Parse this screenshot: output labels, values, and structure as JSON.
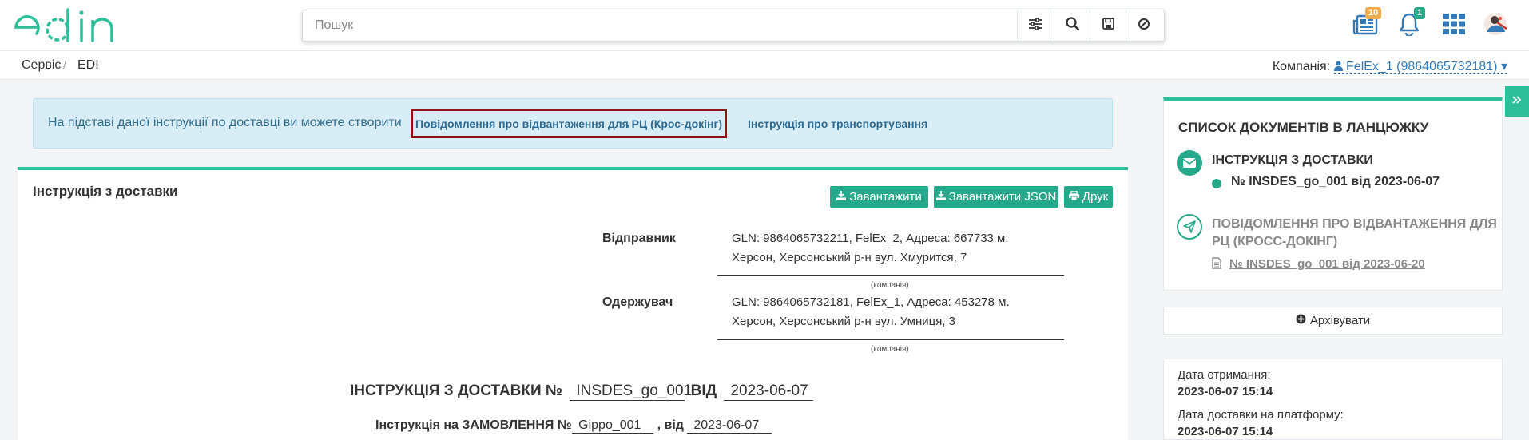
{
  "header": {
    "logo_text": "edin",
    "search_placeholder": "Пошук",
    "search_buttons": [
      "filter-icon",
      "search-icon",
      "save-icon",
      "cancel-icon"
    ],
    "news_badge": "10",
    "notifications_badge": "1",
    "accent_color": "#26a88b",
    "badge_orange": "#f0ad4e"
  },
  "breadcrumb": {
    "items": [
      "Сервіс",
      "EDI"
    ],
    "company_label": "Компанія:",
    "company_value": "FelEx_1 (9864065732181)"
  },
  "alert": {
    "text": "На підставі даної інструкції по доставці ви можете створити",
    "link1": "Повідомлення про відвантаження для РЦ (Крос-докінг)",
    "separator": ",",
    "link2": "Інструкція про транспортування"
  },
  "document": {
    "title": "Інструкція з доставки",
    "buttons": {
      "download": "Завантажити",
      "download_json": "Завантажити JSON",
      "print": "Друк"
    },
    "sender_label": "Відправник",
    "sender_line1": "GLN: 9864065732211, FelEx_2, Адреса: 667733 м.",
    "sender_line2": "Херсон, Херсонський р-н вул. Хмурится, 7",
    "company_caption": "(компанія)",
    "receiver_label": "Одержувач",
    "receiver_line1": "GLN: 9864065732181, FelEx_1, Адреса: 453278 м.",
    "receiver_line2": "Херсон, Херсонський р-н вул. Умниця, 3",
    "heading_prefix": "ІНСТРУКЦІЯ З ДОСТАВКИ №",
    "heading_number": "INSDES_go_001",
    "heading_from": "ВІД",
    "heading_date": "2023-06-07",
    "order_prefix": "Інструкція на ЗАМОВЛЕННЯ №",
    "order_number": "Gippo_001",
    "order_from": ", від",
    "order_date": "2023-06-07"
  },
  "chain": {
    "title": "СПИСОК ДОКУМЕНТІВ В ЛАНЦЮЖКУ",
    "item1_title": "ІНСТРУКЦІЯ З ДОСТАВКИ",
    "item1_doc": "№ INSDES_go_001 від 2023-06-07",
    "item2_title": "ПОВІДОМЛЕННЯ ПРО ВІДВАНТАЖЕННЯ ДЛЯ РЦ (КРОСС-ДОКІНГ)",
    "item2_doc": "№ INSDES_go_001 від 2023-06-20"
  },
  "archive_button": "Архівувати",
  "info": {
    "received_label": "Дата отримання:",
    "received_value": "2023-06-07 15:14",
    "delivered_label": "Дата доставки на платформу:",
    "delivered_value": "2023-06-07 15:14"
  }
}
